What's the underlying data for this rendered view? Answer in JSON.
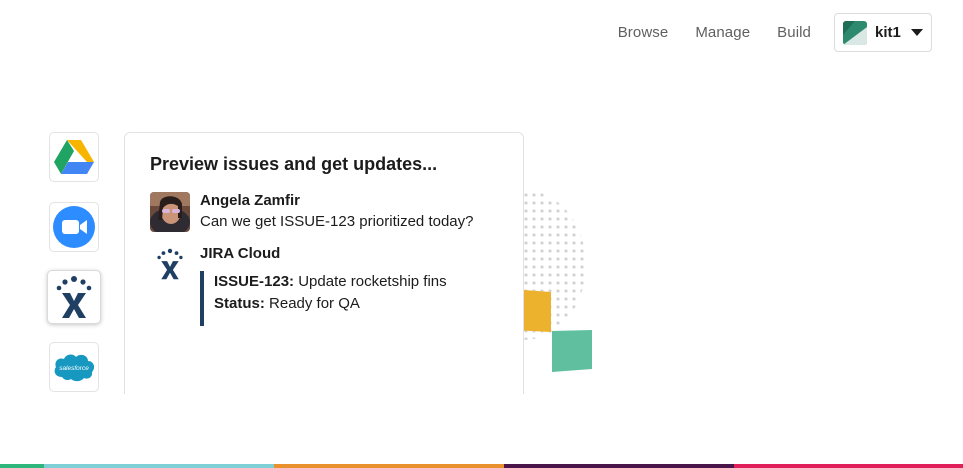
{
  "nav": {
    "links": [
      "Browse",
      "Manage",
      "Build"
    ],
    "workspace": {
      "name": "kit1",
      "logo_icon": "workspace-logo-icon",
      "caret_icon": "caret-down-icon"
    }
  },
  "apps": [
    {
      "name": "Google Drive",
      "icon": "google-drive-icon"
    },
    {
      "name": "Zoom",
      "icon": "zoom-icon"
    },
    {
      "name": "JIRA Cloud",
      "icon": "jira-icon",
      "active": true
    },
    {
      "name": "Salesforce",
      "icon": "salesforce-icon",
      "label": "salesforce"
    }
  ],
  "card": {
    "title": "Preview issues and get updates...",
    "messages": [
      {
        "sender": "Angela Zamfir",
        "text": "Can we get ISSUE-123 prioritized today?"
      },
      {
        "sender": "JIRA Cloud",
        "attachment": {
          "issue_key": "ISSUE-123:",
          "issue_title": "Update rocketship fins",
          "status_label": "Status:",
          "status_value": "Ready for QA"
        }
      }
    ]
  },
  "colors": {
    "accent_navy": "#1f3f63",
    "decor_yellow": "#ecb22e",
    "decor_green": "#5fbf9f",
    "stripe": [
      "#2eb67d",
      "#7fcfd6",
      "#e8912d",
      "#4a154b",
      "#e01e5a"
    ]
  }
}
